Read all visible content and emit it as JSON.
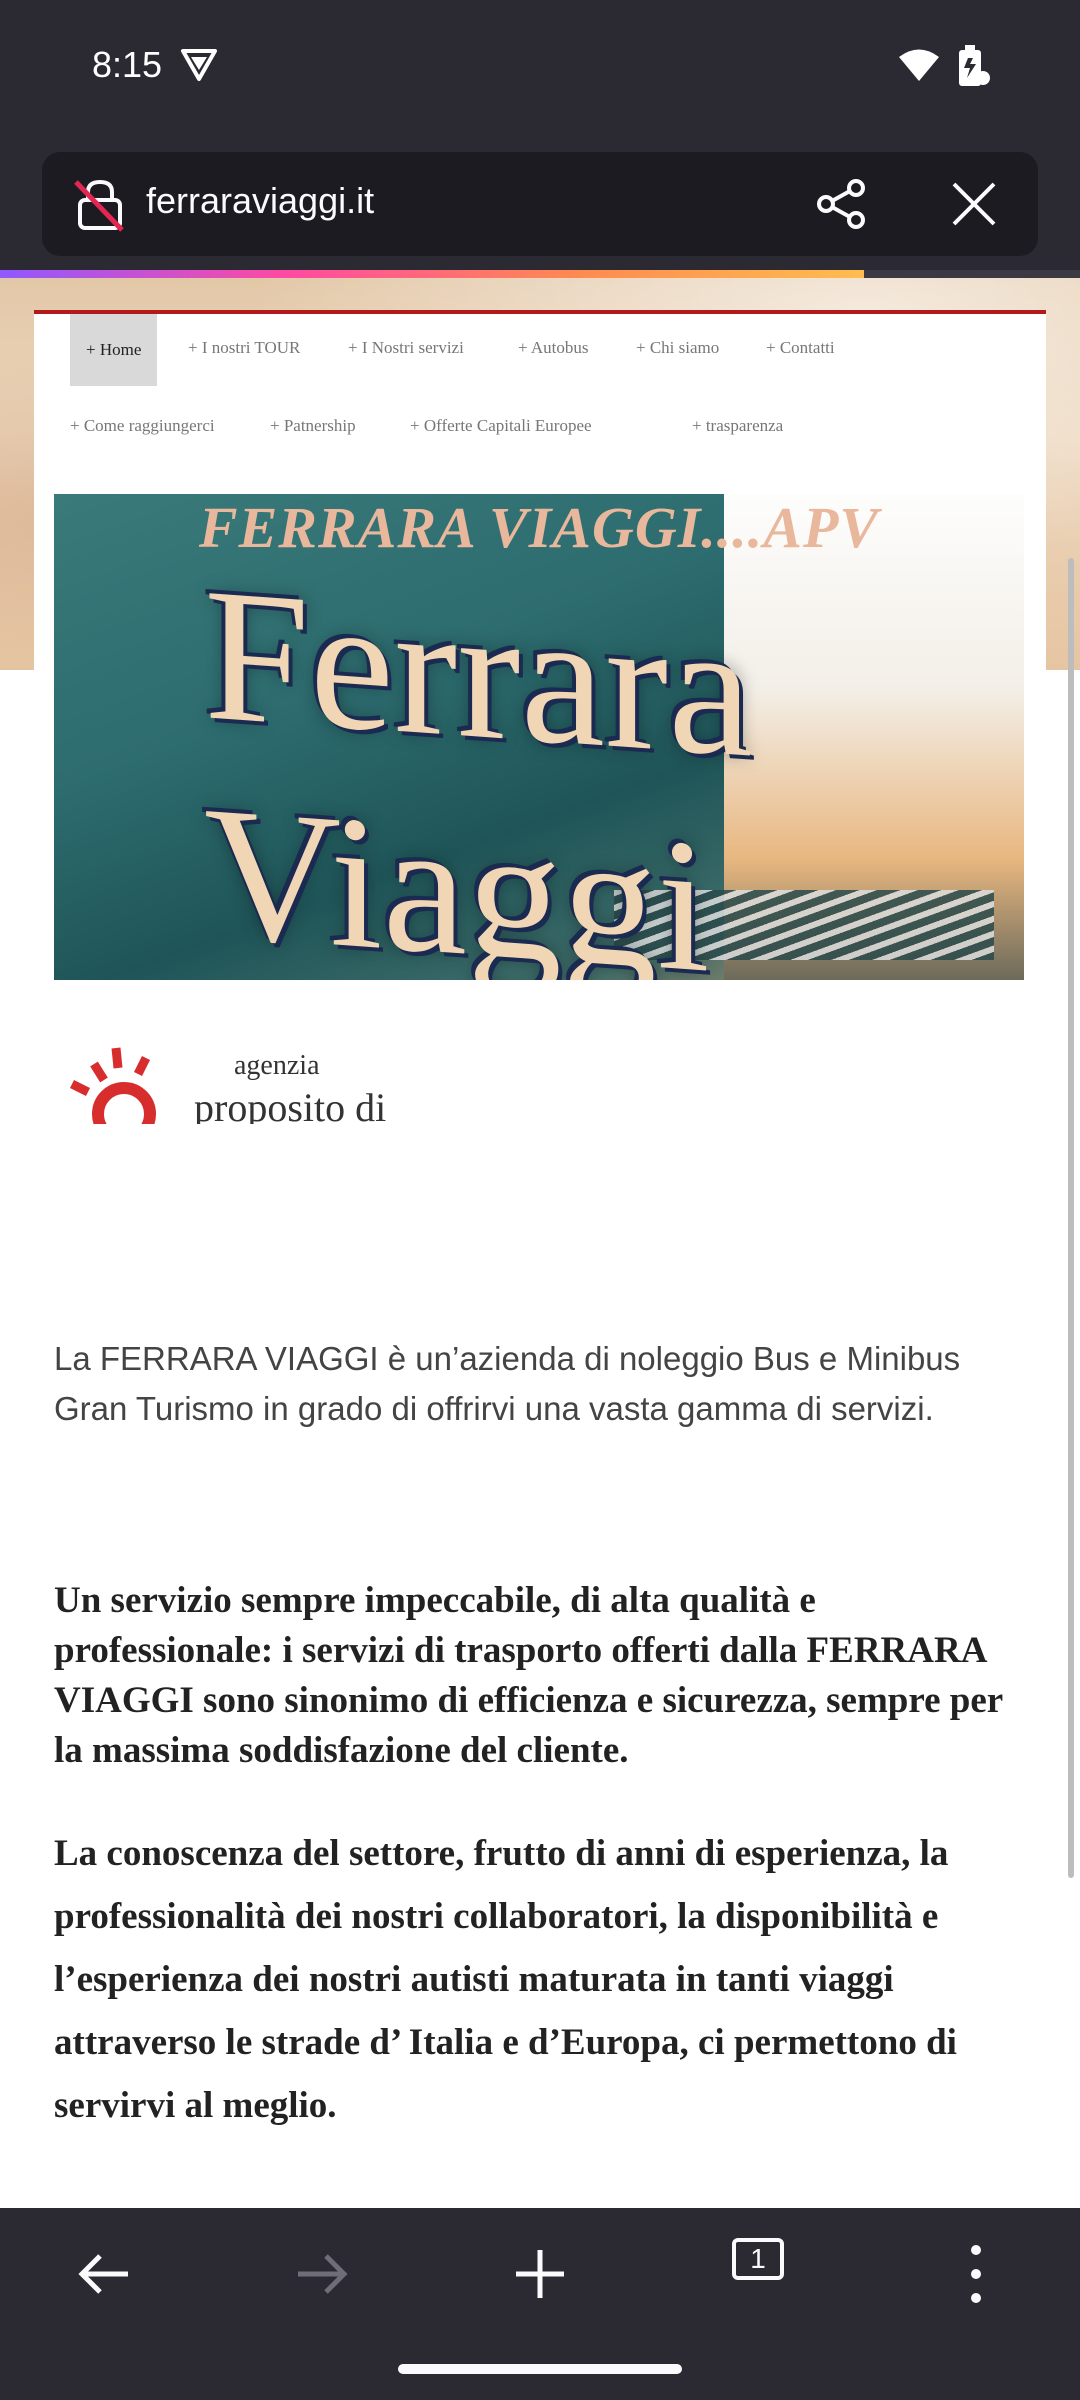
{
  "status_bar": {
    "time": "8:15"
  },
  "browser": {
    "url": "ferraraviaggi.it",
    "load_progress": 0.8,
    "tab_count": "1"
  },
  "site": {
    "nav_row1": [
      "+ Home",
      "+ I nostri TOUR",
      "+ I Nostri servizi",
      "+ Autobus",
      "+ Chi siamo",
      "+ Contatti"
    ],
    "nav_row2": [
      "+ Come raggiungerci",
      "+ Patnership",
      "+ Offerte Capitali Europee",
      "+ trasparenza"
    ],
    "banner_title": "FERRARA VIAGGI....APV",
    "banner_logo": "Ferrara Viaggi",
    "agency_small": "agenzia",
    "agency_big": "proposito di",
    "intro": "La FERRARA VIAGGI è un’azienda di noleggio Bus e Minibus Gran Turismo in grado di offrirvi una vasta gamma di servizi.",
    "bold_para_1": "Un servizio sempre impeccabile, di alta qualità e professionale: i servizi di trasporto offerti dalla FERRARA VIAGGI sono sinonimo di efficienza e sicurezza, sempre per la massima soddisfazione del cliente.",
    "bold_para_2": "La conoscenza del settore, frutto di anni di esperienza, la professionalità dei nostri collaboratori, la disponibilità e l’esperienza dei nostri autisti maturata in tanti viaggi attraverso le strade d’ Italia e d’Europa, ci permettono di servirvi al meglio."
  },
  "icons": {
    "status": [
      "vpn-icon",
      "wifi-icon",
      "battery-icon"
    ],
    "url_bar": [
      "insecure-lock-icon",
      "share-icon",
      "close-icon"
    ],
    "toolbar": [
      "back-arrow-icon",
      "forward-arrow-icon",
      "plus-icon",
      "tabs-icon",
      "menu-dots-icon"
    ]
  },
  "colors": {
    "chrome_bg": "#2b2a33",
    "url_bar_bg": "#1c1b22",
    "site_accent": "#b01a1a",
    "lock_slash": "#e22850"
  }
}
